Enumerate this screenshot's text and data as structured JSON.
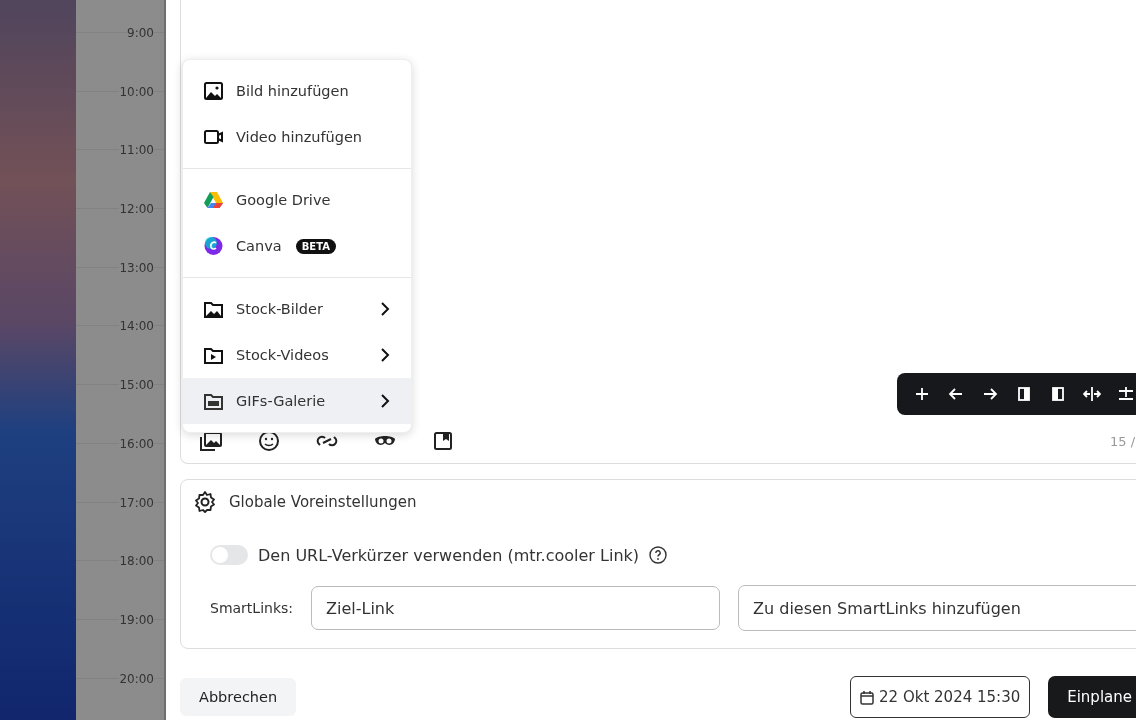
{
  "calendar": {
    "times": [
      "9:00",
      "10:00",
      "11:00",
      "12:00",
      "13:00",
      "14:00",
      "15:00",
      "16:00",
      "17:00",
      "18:00",
      "19:00",
      "20:00"
    ]
  },
  "menu": {
    "sections": [
      [
        {
          "kind": "image",
          "label": "Bild hinzufügen",
          "submenu": false,
          "selected": false
        },
        {
          "kind": "video",
          "label": "Video hinzufügen",
          "submenu": false,
          "selected": false
        }
      ],
      [
        {
          "kind": "drive",
          "label": "Google Drive",
          "submenu": false,
          "selected": false
        },
        {
          "kind": "canva",
          "label": "Canva",
          "badge": "BETA",
          "submenu": false,
          "selected": false
        }
      ],
      [
        {
          "kind": "stock-images",
          "label": "Stock-Bilder",
          "submenu": true,
          "selected": false
        },
        {
          "kind": "stock-videos",
          "label": "Stock-Videos",
          "submenu": true,
          "selected": false
        },
        {
          "kind": "gifs",
          "label": "GIFs-Galerie",
          "submenu": true,
          "selected": true
        }
      ]
    ]
  },
  "editor": {
    "char_count": "15 /"
  },
  "settings": {
    "title": "Globale Voreinstellungen",
    "shortener": {
      "label": "Den URL-Verkürzer verwenden (mtr.cooler Link)",
      "on": false
    },
    "smartlinks": {
      "label": "SmartLinks:",
      "placeholder": "Ziel-Link",
      "select": "Zu diesen SmartLinks hinzufügen"
    }
  },
  "footer": {
    "cancel": "Abbrechen",
    "date": "22 Okt 2024 15:30",
    "submit": "Einplane"
  }
}
